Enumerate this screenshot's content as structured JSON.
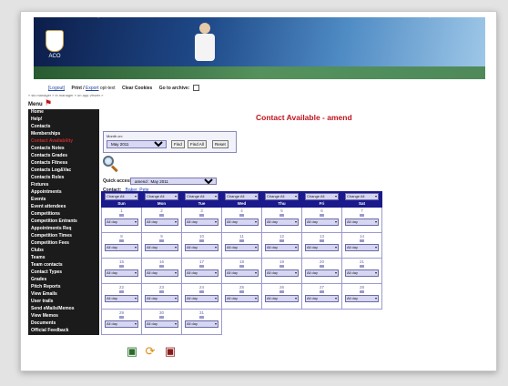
{
  "header": {
    "logo_text": "ACO",
    "links": [
      "[Logout]",
      "Print /",
      "Export",
      "opt-text"
    ],
    "clear_cookies": "Clear Cookies",
    "go_to_archive": "Go to archive:",
    "breadcrumb": "» sis manager » in manager » on app-viewer »"
  },
  "menu": {
    "label": "Menu",
    "items": [
      {
        "label": "Home",
        "active": false
      },
      {
        "label": "Help!",
        "active": false
      },
      {
        "label": "Contacts",
        "active": false
      },
      {
        "label": "Memberships",
        "active": false
      },
      {
        "label": "Contact Availability",
        "active": true
      },
      {
        "label": "Contacts Notes",
        "active": false
      },
      {
        "label": "Contacts Grades",
        "active": false
      },
      {
        "label": "Contacts Fitness",
        "active": false
      },
      {
        "label": "Contacts Log&Vac",
        "active": false
      },
      {
        "label": "Contacts Roles",
        "active": false
      },
      {
        "label": "Fixtures",
        "active": false
      },
      {
        "label": "Appointments",
        "active": false
      },
      {
        "label": "Events",
        "active": false
      },
      {
        "label": "Event attendees",
        "active": false
      },
      {
        "label": "Competitions",
        "active": false
      },
      {
        "label": "Competition Entrants",
        "active": false
      },
      {
        "label": "Appointments Req",
        "active": false
      },
      {
        "label": "Competition Times",
        "active": false
      },
      {
        "label": "Competition Fees",
        "active": false
      },
      {
        "label": "Clubs",
        "active": false
      },
      {
        "label": "Teams",
        "active": false
      },
      {
        "label": "Team contacts",
        "active": false
      },
      {
        "label": "Contact Types",
        "active": false
      },
      {
        "label": "Grades",
        "active": false
      },
      {
        "label": "Pitch Reports",
        "active": false
      },
      {
        "label": "View Emails",
        "active": false
      },
      {
        "label": "User trails",
        "active": false
      },
      {
        "label": "Send eMails/Memos",
        "active": false
      },
      {
        "label": "View Memos",
        "active": false
      },
      {
        "label": "Documents",
        "active": false
      },
      {
        "label": "Official Feedback",
        "active": false
      }
    ]
  },
  "page": {
    "title": "Contact Available - amend",
    "month_label": "Month on:",
    "month_value": "May 2011",
    "find_label": "Find",
    "find_all_label": "Find All",
    "reset_label": "Reset",
    "quick_access_label": "Quick access:",
    "quick_access_value": "amend : May 2011",
    "contact_label": "Contact:",
    "contact_name": "Baker, Pete"
  },
  "calendar": {
    "change_all_label": "Change All",
    "weekdays": [
      "Sun",
      "Mon",
      "Tue",
      "Wed",
      "Thu",
      "Fri",
      "Sat"
    ],
    "weeks": [
      [
        "1",
        "2",
        "3",
        "4",
        "5",
        "6",
        "7"
      ],
      [
        "8",
        "9",
        "10",
        "11",
        "12",
        "13",
        "14"
      ],
      [
        "15",
        "16",
        "17",
        "18",
        "19",
        "20",
        "21"
      ],
      [
        "22",
        "23",
        "24",
        "25",
        "26",
        "27",
        "28"
      ],
      [
        "29",
        "30",
        "31",
        "",
        "",
        "",
        ""
      ]
    ],
    "cell_value": "All day"
  },
  "colors": {
    "accent_red": "#c0131e",
    "calendar_header": "#1a1a8c",
    "sidebar_bg": "#1b1b1b"
  },
  "icons": {
    "menu": "pin-icon",
    "search": "magnifier-icon",
    "bottom": [
      "save-disk-icon",
      "refresh-icon",
      "delete-disk-icon"
    ]
  }
}
